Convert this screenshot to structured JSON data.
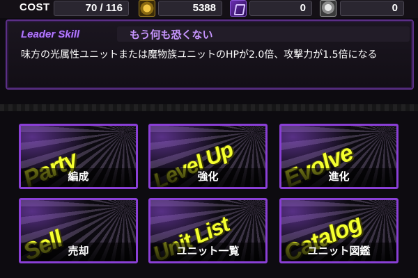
{
  "stats": {
    "cost_label": "COST",
    "cost_value": "70 / 116",
    "gold_value": "5388",
    "purple_value": "0",
    "grey_value": "0"
  },
  "leader": {
    "title": "Leader Skill",
    "skill_name": "もう何も恐くない",
    "description": "味方の光属性ユニットまたは魔物族ユニットのHPが2.0倍、攻撃力が1.5倍になる"
  },
  "menu": [
    {
      "word": "Party",
      "label": "編成"
    },
    {
      "word": "Level Up",
      "label": "強化"
    },
    {
      "word": "Evolve",
      "label": "進化"
    },
    {
      "word": "Sell",
      "label": "売却"
    },
    {
      "word": "Unit List",
      "label": "ユニット一覧"
    },
    {
      "word": "Catalog",
      "label": "ユニット図鑑"
    }
  ],
  "colors": {
    "accent": "#8a3fd6",
    "tile_text": "#f4ff2f",
    "leader_title": "#b279ff"
  },
  "icons": {
    "gold": "gold-coin-icon",
    "purple": "purple-item-icon",
    "grey": "grey-medal-icon"
  }
}
